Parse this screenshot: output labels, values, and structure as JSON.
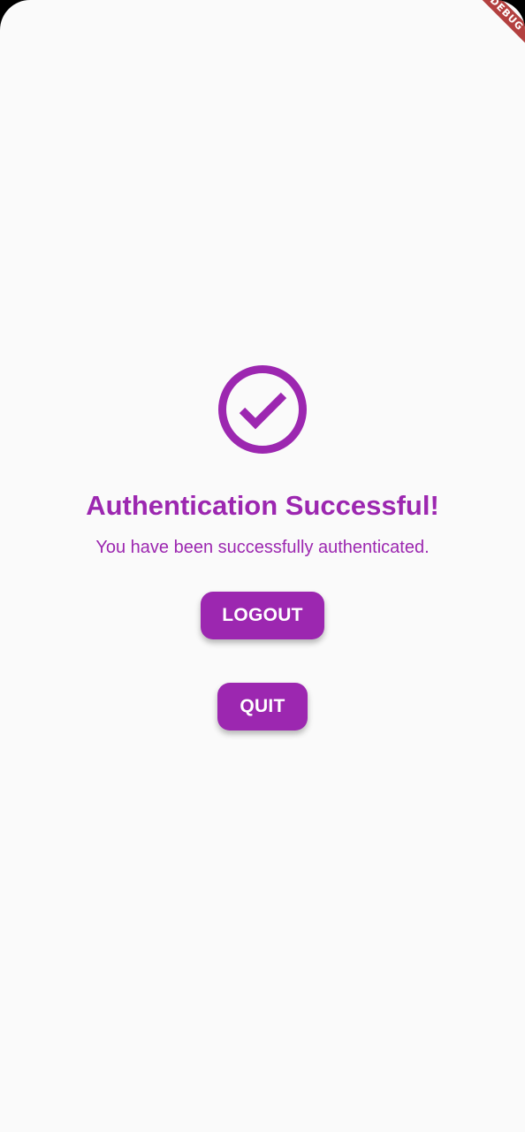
{
  "debug_banner": {
    "label": "DEBUG"
  },
  "success": {
    "icon": "check-circle-icon",
    "title": "Authentication Successful!",
    "message": "You have been successfully authenticated."
  },
  "actions": {
    "logout_label": "LOGOUT",
    "quit_label": "QUIT"
  },
  "colors": {
    "accent": "#9c27b0",
    "background": "#fafafa",
    "button_text": "#ffffff",
    "debug_banner": "#b3403f"
  }
}
